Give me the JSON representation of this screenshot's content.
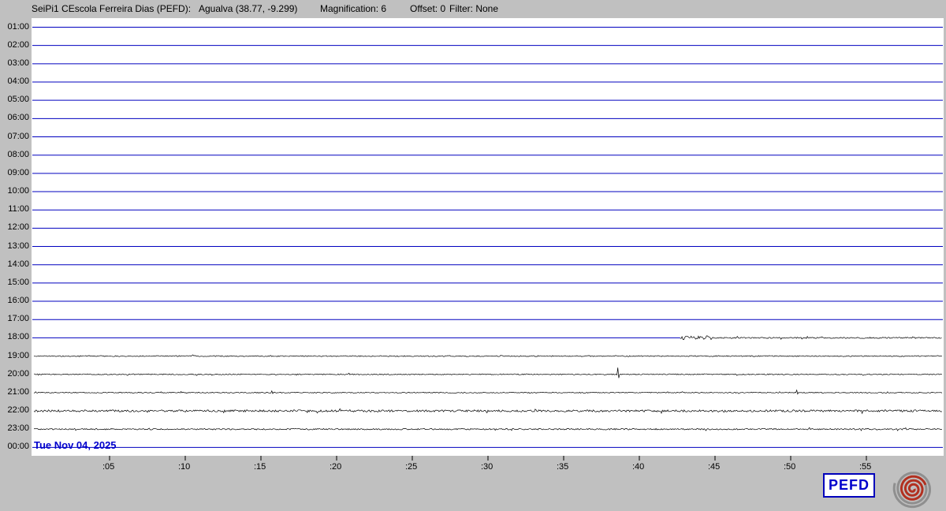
{
  "header": {
    "station": "SeiPi1 CEscola Ferreira Dias (PEFD):",
    "location": "Agualva (38.77, -9.299)",
    "magnification": "Magnification: 6",
    "offset": "Offset: 0",
    "filter": "Filter: None"
  },
  "date_label": "Tue Nov 04, 2025",
  "badge": "PEFD",
  "x_ticks": [
    ":05",
    ":10",
    ":15",
    ":20",
    ":25",
    ":30",
    ":35",
    ":40",
    ":45",
    ":50",
    ":55"
  ],
  "chart_data": {
    "type": "line",
    "description": "24-hour helicorder seismogram, one horizontal trace per hour; blue flat lines = no recorded data, black noisy lines = recorded ground motion",
    "x_axis": "minutes past the hour (0-60), ticks every 5 minutes",
    "quiet_color": "#0000bf",
    "active_color": "#000000",
    "rows": [
      {
        "label": "01:00",
        "type": "flat"
      },
      {
        "label": "02:00",
        "type": "flat"
      },
      {
        "label": "03:00",
        "type": "flat"
      },
      {
        "label": "04:00",
        "type": "flat"
      },
      {
        "label": "05:00",
        "type": "flat"
      },
      {
        "label": "06:00",
        "type": "flat"
      },
      {
        "label": "07:00",
        "type": "flat"
      },
      {
        "label": "08:00",
        "type": "flat"
      },
      {
        "label": "09:00",
        "type": "flat"
      },
      {
        "label": "10:00",
        "type": "flat"
      },
      {
        "label": "11:00",
        "type": "flat"
      },
      {
        "label": "12:00",
        "type": "flat"
      },
      {
        "label": "13:00",
        "type": "flat"
      },
      {
        "label": "14:00",
        "type": "flat"
      },
      {
        "label": "15:00",
        "type": "flat"
      },
      {
        "label": "16:00",
        "type": "flat"
      },
      {
        "label": "17:00",
        "type": "flat"
      },
      {
        "label": "18:00",
        "type": "partial",
        "start_min": 42.7,
        "burst_until": 44.8,
        "burst_amp": 2.6,
        "amp": 0.8
      },
      {
        "label": "19:00",
        "type": "noise",
        "amp": 0.65
      },
      {
        "label": "20:00",
        "type": "noise",
        "amp": 0.65,
        "spikes": [
          {
            "min": 38.6,
            "amp": 8.5
          }
        ]
      },
      {
        "label": "21:00",
        "type": "noise",
        "amp": 0.6,
        "spikes": [
          {
            "min": 15.7,
            "amp": 2.2
          },
          {
            "min": 50.4,
            "amp": 3.2
          }
        ]
      },
      {
        "label": "22:00",
        "type": "noise",
        "amp": 1.3
      },
      {
        "label": "23:00",
        "type": "noise",
        "amp": 0.85
      },
      {
        "label": "00:00",
        "type": "flat"
      }
    ]
  },
  "colors": {
    "background": "#c0c0c0",
    "plot_background": "#ffffff",
    "quiet_trace": "#0000bf",
    "active_trace": "#000000",
    "date_text": "#0000cc",
    "badge_blue": "#0000bb",
    "logo_gray": "#8f8f8f",
    "logo_red": "#b23020"
  }
}
